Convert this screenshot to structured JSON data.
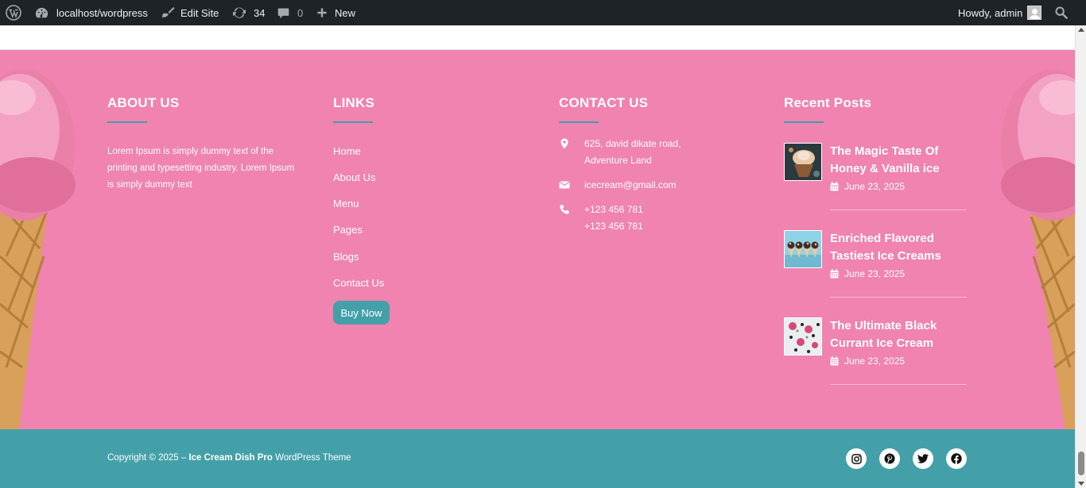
{
  "adminbar": {
    "site": "localhost/wordpress",
    "edit_site": "Edit Site",
    "updates_count": "34",
    "comments_count": "0",
    "new": "New",
    "howdy": "Howdy, admin"
  },
  "footer": {
    "about": {
      "title": "ABOUT US",
      "text": "Lorem Ipsum is simply dummy text of the printing and typesetting industry. Lorem Ipsum is simply dummy text"
    },
    "links": {
      "title": "LINKS",
      "items": [
        "Home",
        "About Us",
        "Menu",
        "Pages",
        "Blogs",
        "Contact Us"
      ],
      "button": "Buy Now"
    },
    "contact": {
      "title": "CONTACT US",
      "address_line1": "625, david dikate road,",
      "address_line2": "Adventure Land",
      "email": "icecream@gmail.com",
      "phone1": "+123 456 781",
      "phone2": "+123 456 781"
    },
    "recent": {
      "title": "Recent Posts",
      "posts": [
        {
          "title": "The Magic Taste Of Honey & Vanilla ice",
          "date": "June 23, 2025"
        },
        {
          "title": "Enriched Flavored Tastiest Ice Creams",
          "date": "June 23, 2025"
        },
        {
          "title": "The Ultimate Black Currant Ice Cream",
          "date": "June 23, 2025"
        }
      ]
    }
  },
  "bottom": {
    "copyright_prefix": "Copyright © 2025 –",
    "theme_name": "Ice Cream Dish Pro",
    "copyright_suffix": "WordPress Theme"
  },
  "colors": {
    "admin_bar": "#1d2327",
    "footer_pink": "#f083b0",
    "accent_teal": "#43a0a8"
  },
  "icons": [
    "wordpress-icon",
    "dashboard-icon",
    "brush-icon",
    "updates-icon",
    "comment-icon",
    "plus-icon",
    "search-icon",
    "map-marker-icon",
    "envelope-icon",
    "phone-icon",
    "calendar-icon",
    "instagram-icon",
    "pinterest-icon",
    "twitter-icon",
    "facebook-icon"
  ]
}
